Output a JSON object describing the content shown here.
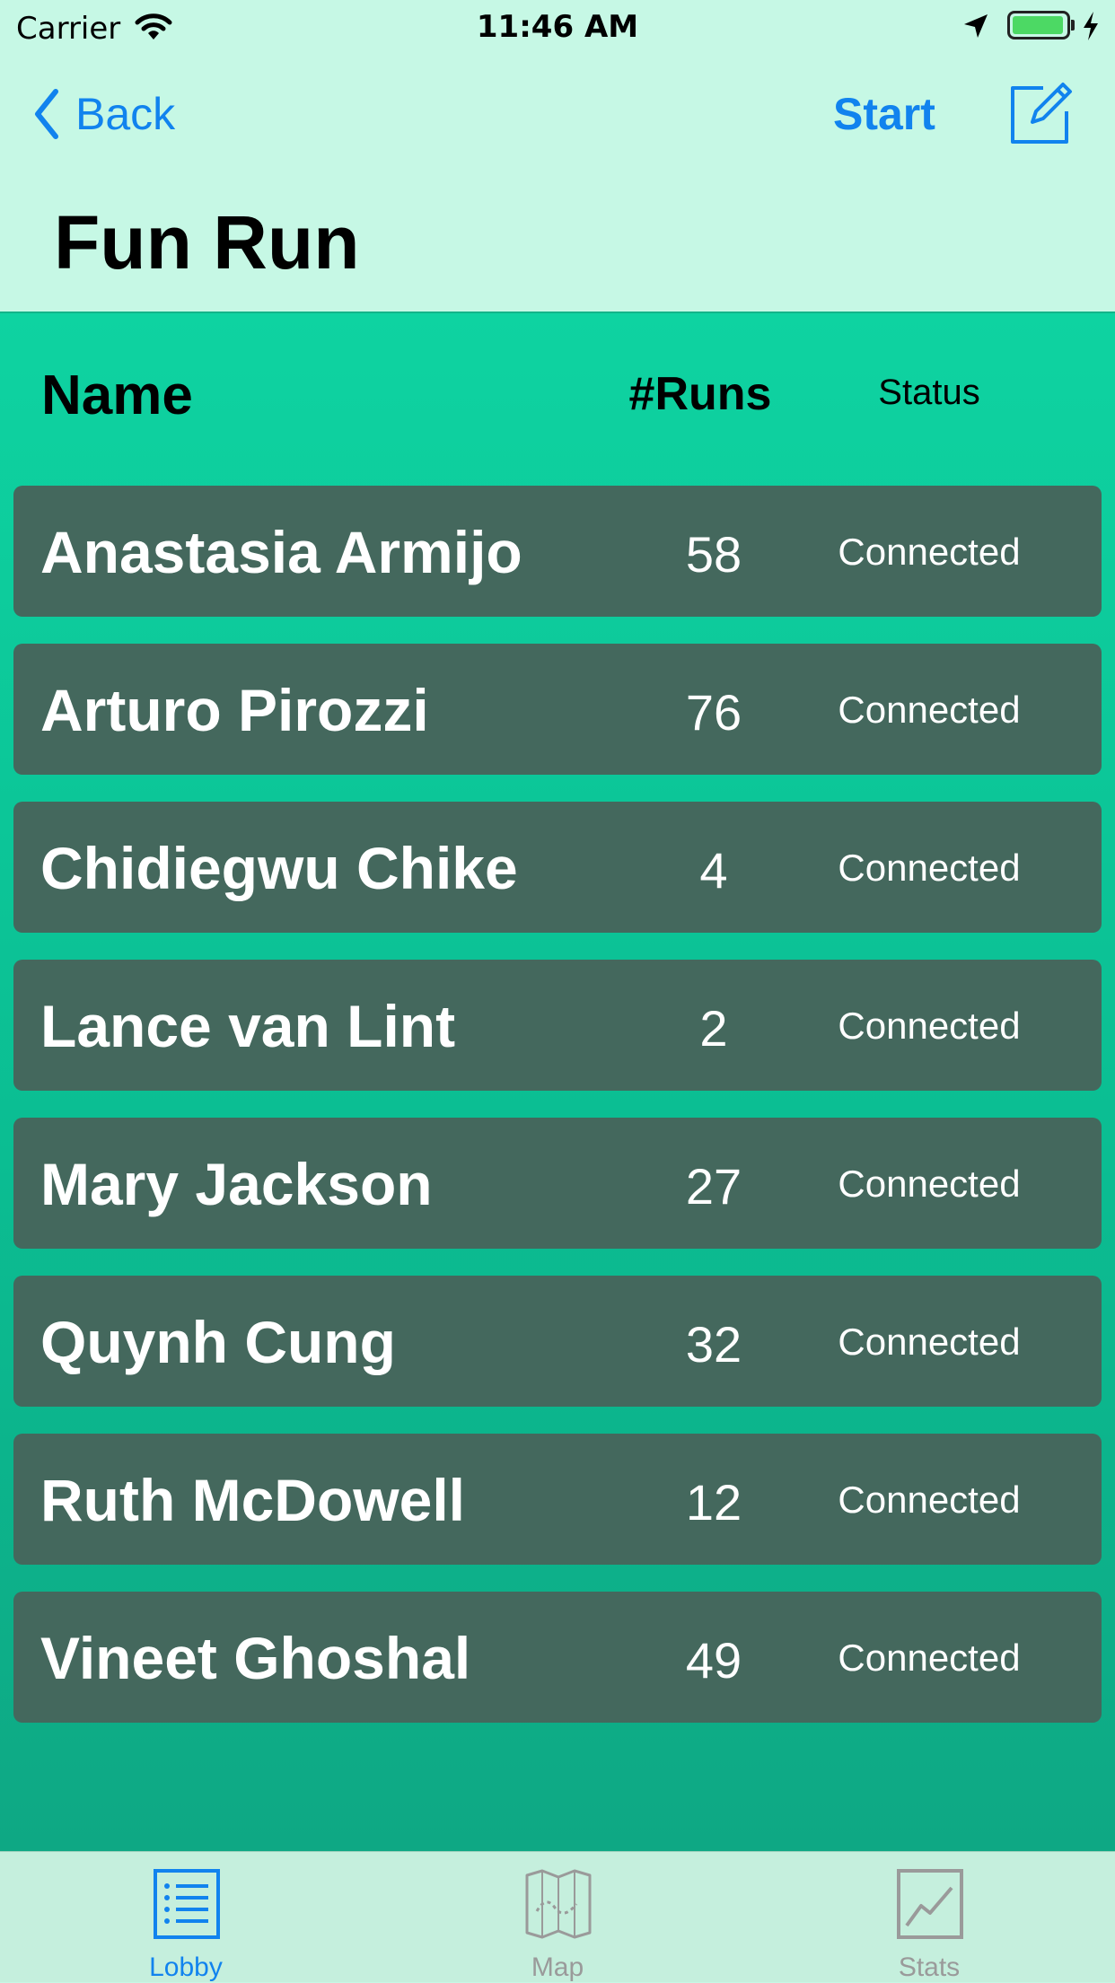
{
  "status_bar": {
    "carrier": "Carrier",
    "time": "11:46 AM"
  },
  "nav": {
    "back_label": "Back",
    "start_label": "Start",
    "title": "Fun Run"
  },
  "table": {
    "headers": {
      "name": "Name",
      "runs": "#Runs",
      "status": "Status"
    },
    "rows": [
      {
        "name": "Anastasia Armijo",
        "runs": "58",
        "status": "Connected"
      },
      {
        "name": "Arturo Pirozzi",
        "runs": "76",
        "status": "Connected"
      },
      {
        "name": "Chidiegwu Chike",
        "runs": "4",
        "status": "Connected"
      },
      {
        "name": "Lance van Lint",
        "runs": "2",
        "status": "Connected"
      },
      {
        "name": "Mary Jackson",
        "runs": "27",
        "status": "Connected"
      },
      {
        "name": "Quynh Cung",
        "runs": "32",
        "status": "Connected"
      },
      {
        "name": "Ruth McDowell",
        "runs": "12",
        "status": "Connected"
      },
      {
        "name": "Vineet Ghoshal",
        "runs": "49",
        "status": "Connected"
      }
    ]
  },
  "tab_bar": {
    "tabs": [
      {
        "label": "Lobby",
        "icon": "list-icon",
        "active": true
      },
      {
        "label": "Map",
        "icon": "map-icon",
        "active": false
      },
      {
        "label": "Stats",
        "icon": "chart-icon",
        "active": false
      }
    ]
  },
  "colors": {
    "accent": "#1183ee",
    "header_background": "#c6f8e5",
    "table_gradient_top": "#0ed3a1",
    "row_background": "#44685d",
    "battery": "#4cd964",
    "tab_inactive": "#9a9a9a"
  }
}
